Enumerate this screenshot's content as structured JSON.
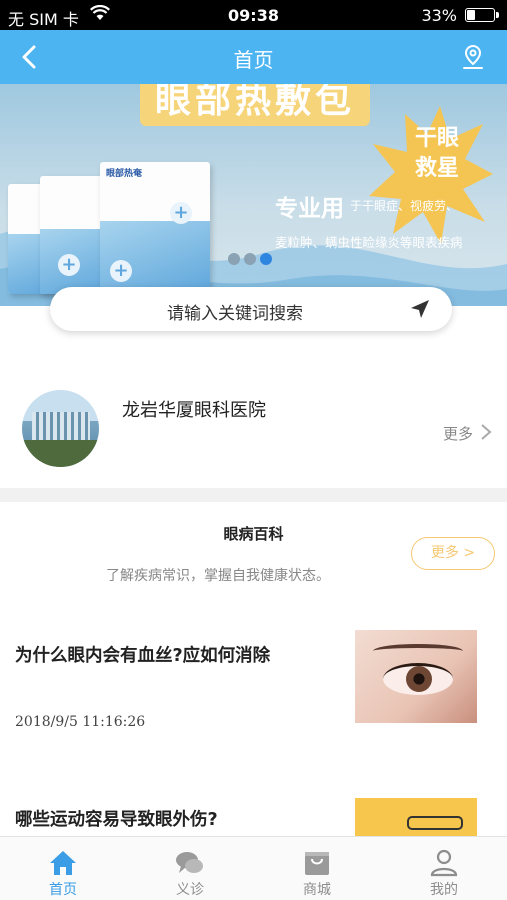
{
  "status_bar": {
    "carrier": "无 SIM 卡",
    "time": "09:38",
    "battery": "33%",
    "battery_level": 0.33
  },
  "nav": {
    "title": "首页",
    "back_icon": "chevron-left-icon",
    "location_icon": "location-pin-icon"
  },
  "banner": {
    "headline": "眼部热敷包",
    "slogan_line1": "干眼",
    "slogan_line2": "救星",
    "pro_label": "专业用",
    "desc_line1": "于干眼症、视疲劳、",
    "desc_line2": "麦粒肿、螨虫性睑缘炎等眼表疾病",
    "product_box_label": "眼部热奄",
    "slide_count": 3,
    "active_slide": 3
  },
  "search": {
    "placeholder": "请输入关键词搜索",
    "icon": "send-arrow-icon"
  },
  "hospital": {
    "name": "龙岩华厦眼科医院",
    "more_label": "更多"
  },
  "encyclopedia": {
    "title": "眼病百科",
    "subtitle": "了解疾病常识，掌握自我健康状态。",
    "more_label": "更多 >",
    "articles": [
      {
        "title": "为什么眼内会有血丝?应如何消除",
        "date": "2018/9/5 11:16:26"
      },
      {
        "title": "哪些运动容易导致眼外伤?"
      }
    ]
  },
  "tabbar": {
    "tabs": [
      {
        "label": "首页",
        "icon": "home-icon",
        "active": true
      },
      {
        "label": "义诊",
        "icon": "chat-bubbles-icon",
        "active": false
      },
      {
        "label": "商城",
        "icon": "shop-icon",
        "active": false
      },
      {
        "label": "我的",
        "icon": "user-icon",
        "active": false
      }
    ]
  },
  "colors": {
    "primary": "#4db4f2",
    "tab_active": "#3a9de6",
    "accent_yellow": "#f5c873",
    "active_dot": "#2f86e0"
  }
}
